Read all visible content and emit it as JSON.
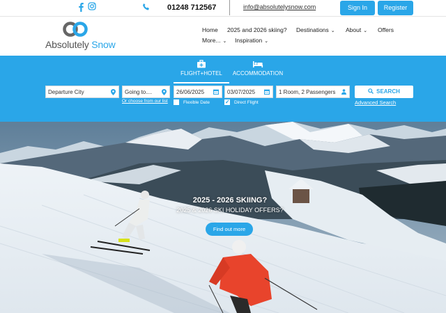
{
  "topbar": {
    "phone": "01248 712567",
    "email": "info@absolutelysnow.com",
    "signin_label": "Sign In",
    "register_label": "Register",
    "icons": [
      "facebook-icon",
      "instagram-icon",
      "phone-icon"
    ]
  },
  "header": {
    "logo_part1": "Absolutely ",
    "logo_part2": "Snow",
    "nav": {
      "home": "Home",
      "skiing": "2025 and 2026 skiing?",
      "destinations": "Destinations",
      "about": "About",
      "offers": "Offers",
      "more": "More...",
      "inspiration": "Inspiration"
    }
  },
  "search": {
    "tab_flight": "FLIGHT+HOTEL",
    "tab_accommodation": "ACCOMMODATION",
    "departure_placeholder": "Departure City",
    "going_placeholder": "Going to....",
    "date_from": "26/06/2025",
    "date_to": "03/07/2025",
    "rooms": "1 Room, 2 Passengers",
    "search_label": "SEARCH",
    "choose_link": "Or choose from our list",
    "flexible_label": "Flexible Date",
    "flexible_checked": false,
    "direct_label": "Direct Flight",
    "direct_checked": true,
    "advanced_label": "Advanced Search"
  },
  "hero": {
    "title": "2025 - 2026 SKIING?",
    "subtitle": "2025 & 2026 SKI HOLIDAY OFFERS?",
    "button_label": "Find out more"
  },
  "colors": {
    "brand_blue": "#2aa6e8",
    "logo_gray": "#555555"
  }
}
